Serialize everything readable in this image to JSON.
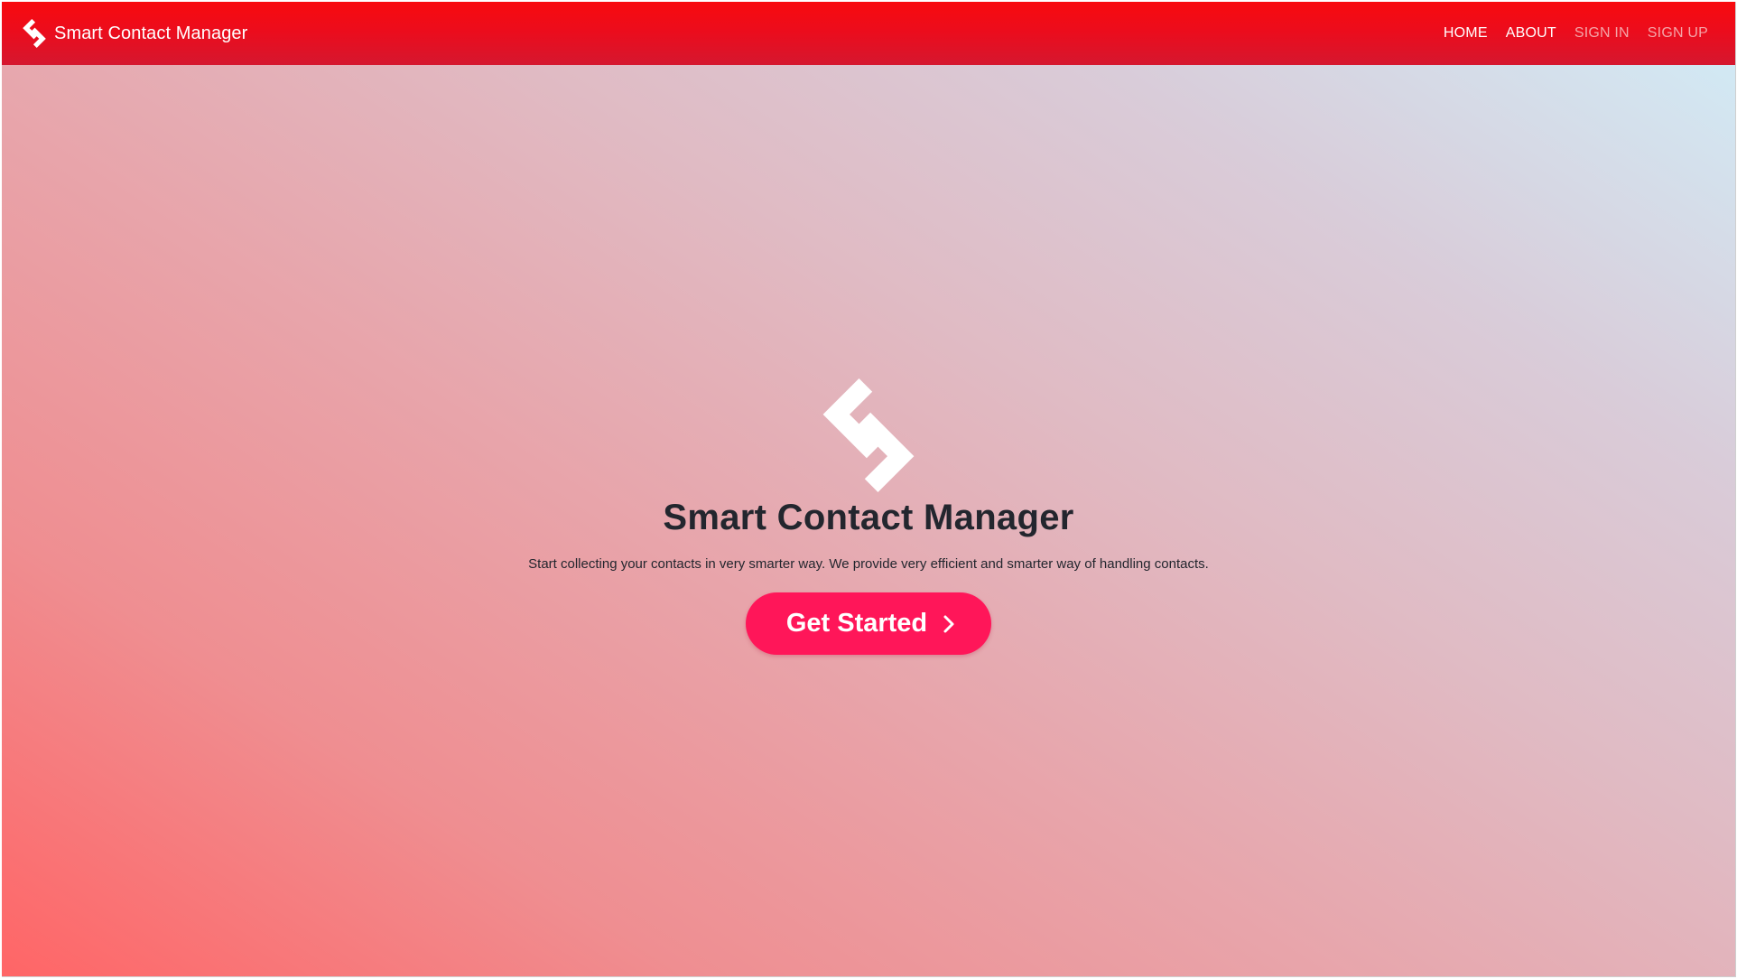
{
  "brand": {
    "logo_icon": "diamond-brackets-logo-icon",
    "name": "Smart Contact Manager"
  },
  "nav": {
    "items": [
      {
        "label": "HOME",
        "state": "active"
      },
      {
        "label": "ABOUT",
        "state": "active"
      },
      {
        "label": "SIGN IN",
        "state": "muted"
      },
      {
        "label": "SIGN UP",
        "state": "muted"
      }
    ]
  },
  "hero": {
    "logo_icon": "diamond-brackets-logo-icon",
    "title": "Smart Contact Manager",
    "subtitle": "Start collecting your contacts in very smarter way. We provide very efficient and smarter way of handling contacts.",
    "cta_label": "Get Started",
    "cta_icon": "chevron-right-icon"
  },
  "colors": {
    "navbar": "#ef0b17",
    "cta_background": "#ff1659",
    "heading_text": "#23262e",
    "nav_muted": "#f4a5a8",
    "gradient_start": "#ff6566",
    "gradient_end": "#d2e9f4"
  }
}
